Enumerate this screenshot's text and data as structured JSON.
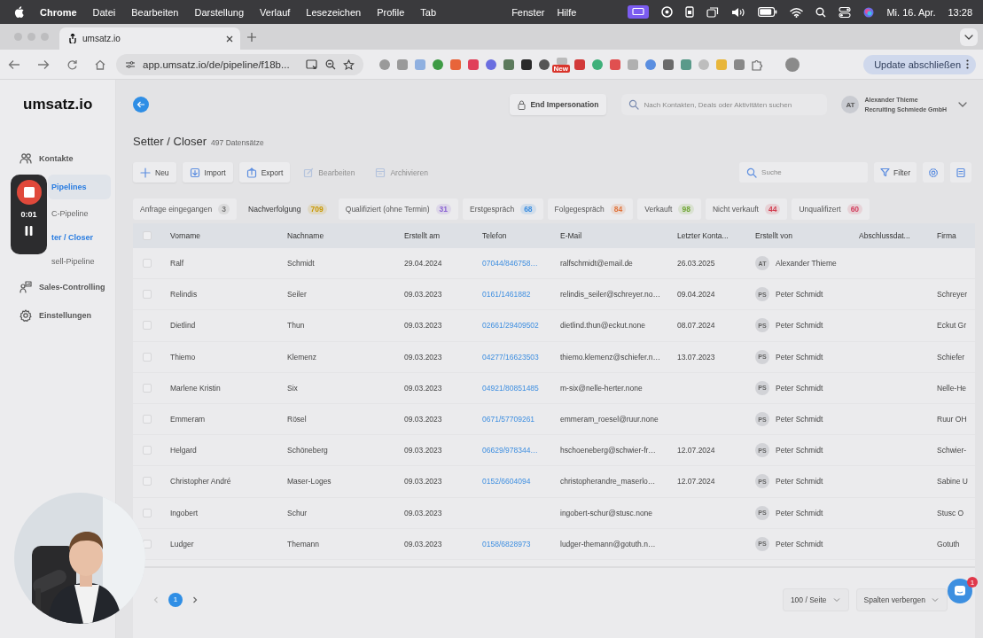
{
  "menu_bar": {
    "app": "Chrome",
    "menus": [
      "Datei",
      "Bearbeiten",
      "Darstellung",
      "Verlauf",
      "Lesezeichen",
      "Profile",
      "Tab"
    ],
    "right_menus": [
      "Fenster",
      "Hilfe"
    ],
    "date": "Mi. 16. Apr.",
    "time": "13:28"
  },
  "browser": {
    "tab_title": "umsatz.io",
    "url": "app.umsatz.io/de/pipeline/f18b...",
    "extension_badge": "New",
    "update_button": "Update abschließen"
  },
  "sidebar": {
    "logo": "umsatz.io",
    "items": [
      {
        "label": "Kontakte",
        "selected": false
      },
      {
        "label": "Pipelines",
        "selected": true,
        "children": [
          {
            "label": "C-Pipeline",
            "selected": false
          },
          {
            "label": "ter / Closer",
            "selected": true
          },
          {
            "label": "sell-Pipeline",
            "selected": false
          }
        ]
      },
      {
        "label": "Sales-Controlling",
        "selected": false
      },
      {
        "label": "Einstellungen",
        "selected": false
      }
    ]
  },
  "recorder": {
    "time": "0:01"
  },
  "header": {
    "impersonation_button": "End Impersonation",
    "search_placeholder": "Nach Kontakten, Deals oder Aktivitäten suchen",
    "user": {
      "initials": "AT",
      "name": "Alexander Thieme",
      "company": "Recruiting Schmiede GmbH"
    }
  },
  "page": {
    "title": "Setter / Closer",
    "count": "497 Datensätze"
  },
  "toolbar": {
    "buttons": [
      {
        "label": "Neu",
        "disabled": false
      },
      {
        "label": "Import",
        "disabled": false
      },
      {
        "label": "Export",
        "disabled": false
      },
      {
        "label": "Bearbeiten",
        "disabled": true
      },
      {
        "label": "Archivieren",
        "disabled": true
      }
    ],
    "search_placeholder": "Suche",
    "filter_button": "Filter"
  },
  "stages": [
    {
      "label": "Anfrage eingegangen",
      "count": "3",
      "color": "#777777",
      "selected": false
    },
    {
      "label": "Nachverfolgung",
      "count": "709",
      "color": "#c99700",
      "selected": true
    },
    {
      "label": "Qualifiziert (ohne Termin)",
      "count": "31",
      "color": "#8a63d2",
      "selected": false
    },
    {
      "label": "Erstgespräch",
      "count": "68",
      "color": "#3b8de0",
      "selected": false
    },
    {
      "label": "Folgegespräch",
      "count": "84",
      "color": "#e0733b",
      "selected": false
    },
    {
      "label": "Verkauft",
      "count": "98",
      "color": "#6fa534",
      "selected": false
    },
    {
      "label": "Nicht verkauft",
      "count": "44",
      "color": "#d23b4e",
      "selected": false
    },
    {
      "label": "Unqualifizert",
      "count": "60",
      "color": "#d2405f",
      "selected": false
    }
  ],
  "table": {
    "header_checked": false,
    "columns": [
      {
        "label": "Vorname",
        "kind": "text"
      },
      {
        "label": "Nachname",
        "kind": "text"
      },
      {
        "label": "Erstellt am",
        "kind": "text"
      },
      {
        "label": "Telefon",
        "kind": "link"
      },
      {
        "label": "E-Mail",
        "kind": "text"
      },
      {
        "label": "Letzter Konta...",
        "kind": "text"
      },
      {
        "label": "Erstellt von",
        "kind": "user"
      },
      {
        "label": "Abschlussdat..."
      },
      {
        "label": "Firma",
        "kind": "text"
      }
    ],
    "rows": [
      {
        "checked": false,
        "cells": [
          "Ralf",
          "Schmidt",
          "29.04.2024",
          "07044/846758…",
          "ralfschmidt@email.de",
          "26.03.2025",
          {
            "initials": "AT",
            "name": "Alexander Thieme"
          },
          null,
          null
        ]
      },
      {
        "checked": false,
        "cells": [
          "Relindis",
          "Seiler",
          "09.03.2023",
          "0161/1461882",
          "relindis_seiler@schreyer.no…",
          "09.04.2024",
          {
            "initials": "PS",
            "name": "Peter Schmidt"
          },
          null,
          "Schreyer"
        ]
      },
      {
        "checked": false,
        "cells": [
          "Dietlind",
          "Thun",
          "09.03.2023",
          "02661/29409502",
          "dietlind.thun@eckut.none",
          "08.07.2024",
          {
            "initials": "PS",
            "name": "Peter Schmidt"
          },
          null,
          "Eckut Gr"
        ]
      },
      {
        "checked": false,
        "cells": [
          "Thiemo",
          "Klemenz",
          "09.03.2023",
          "04277/16623503",
          "thiemo.klemenz@schiefer.n…",
          "13.07.2023",
          {
            "initials": "PS",
            "name": "Peter Schmidt"
          },
          null,
          "Schiefer"
        ]
      },
      {
        "checked": false,
        "cells": [
          "Marlene Kristin",
          "Six",
          "09.03.2023",
          "04921/80851485",
          "m-six@nelle-herter.none",
          null,
          {
            "initials": "PS",
            "name": "Peter Schmidt"
          },
          null,
          "Nelle-He"
        ]
      },
      {
        "checked": false,
        "cells": [
          "Emmeram",
          "Rösel",
          "09.03.2023",
          "0671/57709261",
          "emmeram_roesel@ruur.none",
          null,
          {
            "initials": "PS",
            "name": "Peter Schmidt"
          },
          null,
          "Ruur OH"
        ]
      },
      {
        "checked": false,
        "cells": [
          "Helgard",
          "Schöneberg",
          "09.03.2023",
          "06629/978344…",
          "hschoeneberg@schwier-fr…",
          "12.07.2024",
          {
            "initials": "PS",
            "name": "Peter Schmidt"
          },
          null,
          "Schwier-"
        ]
      },
      {
        "checked": false,
        "cells": [
          "Christopher André",
          "Maser-Loges",
          "09.03.2023",
          "0152/6604094",
          "christopherandre_maserlo…",
          "12.07.2024",
          {
            "initials": "PS",
            "name": "Peter Schmidt"
          },
          null,
          "Sabine U"
        ]
      },
      {
        "checked": false,
        "cells": [
          "Ingobert",
          "Schur",
          "09.03.2023",
          null,
          "ingobert-schur@stusc.none",
          null,
          {
            "initials": "PS",
            "name": "Peter Schmidt"
          },
          null,
          "Stusc O"
        ]
      },
      {
        "checked": false,
        "cells": [
          "Ludger",
          "Themann",
          "09.03.2023",
          "0158/6828973",
          "ludger-themann@gotuth.n…",
          null,
          {
            "initials": "PS",
            "name": "Peter Schmidt"
          },
          null,
          "Gotuth"
        ]
      }
    ]
  },
  "pagination": {
    "prev_disabled": true,
    "pages": [
      {
        "label": "1",
        "selected": true
      }
    ],
    "page_size": "100 / Seite",
    "columns_button": "Spalten verbergen"
  },
  "chat": {
    "badge": "1"
  }
}
